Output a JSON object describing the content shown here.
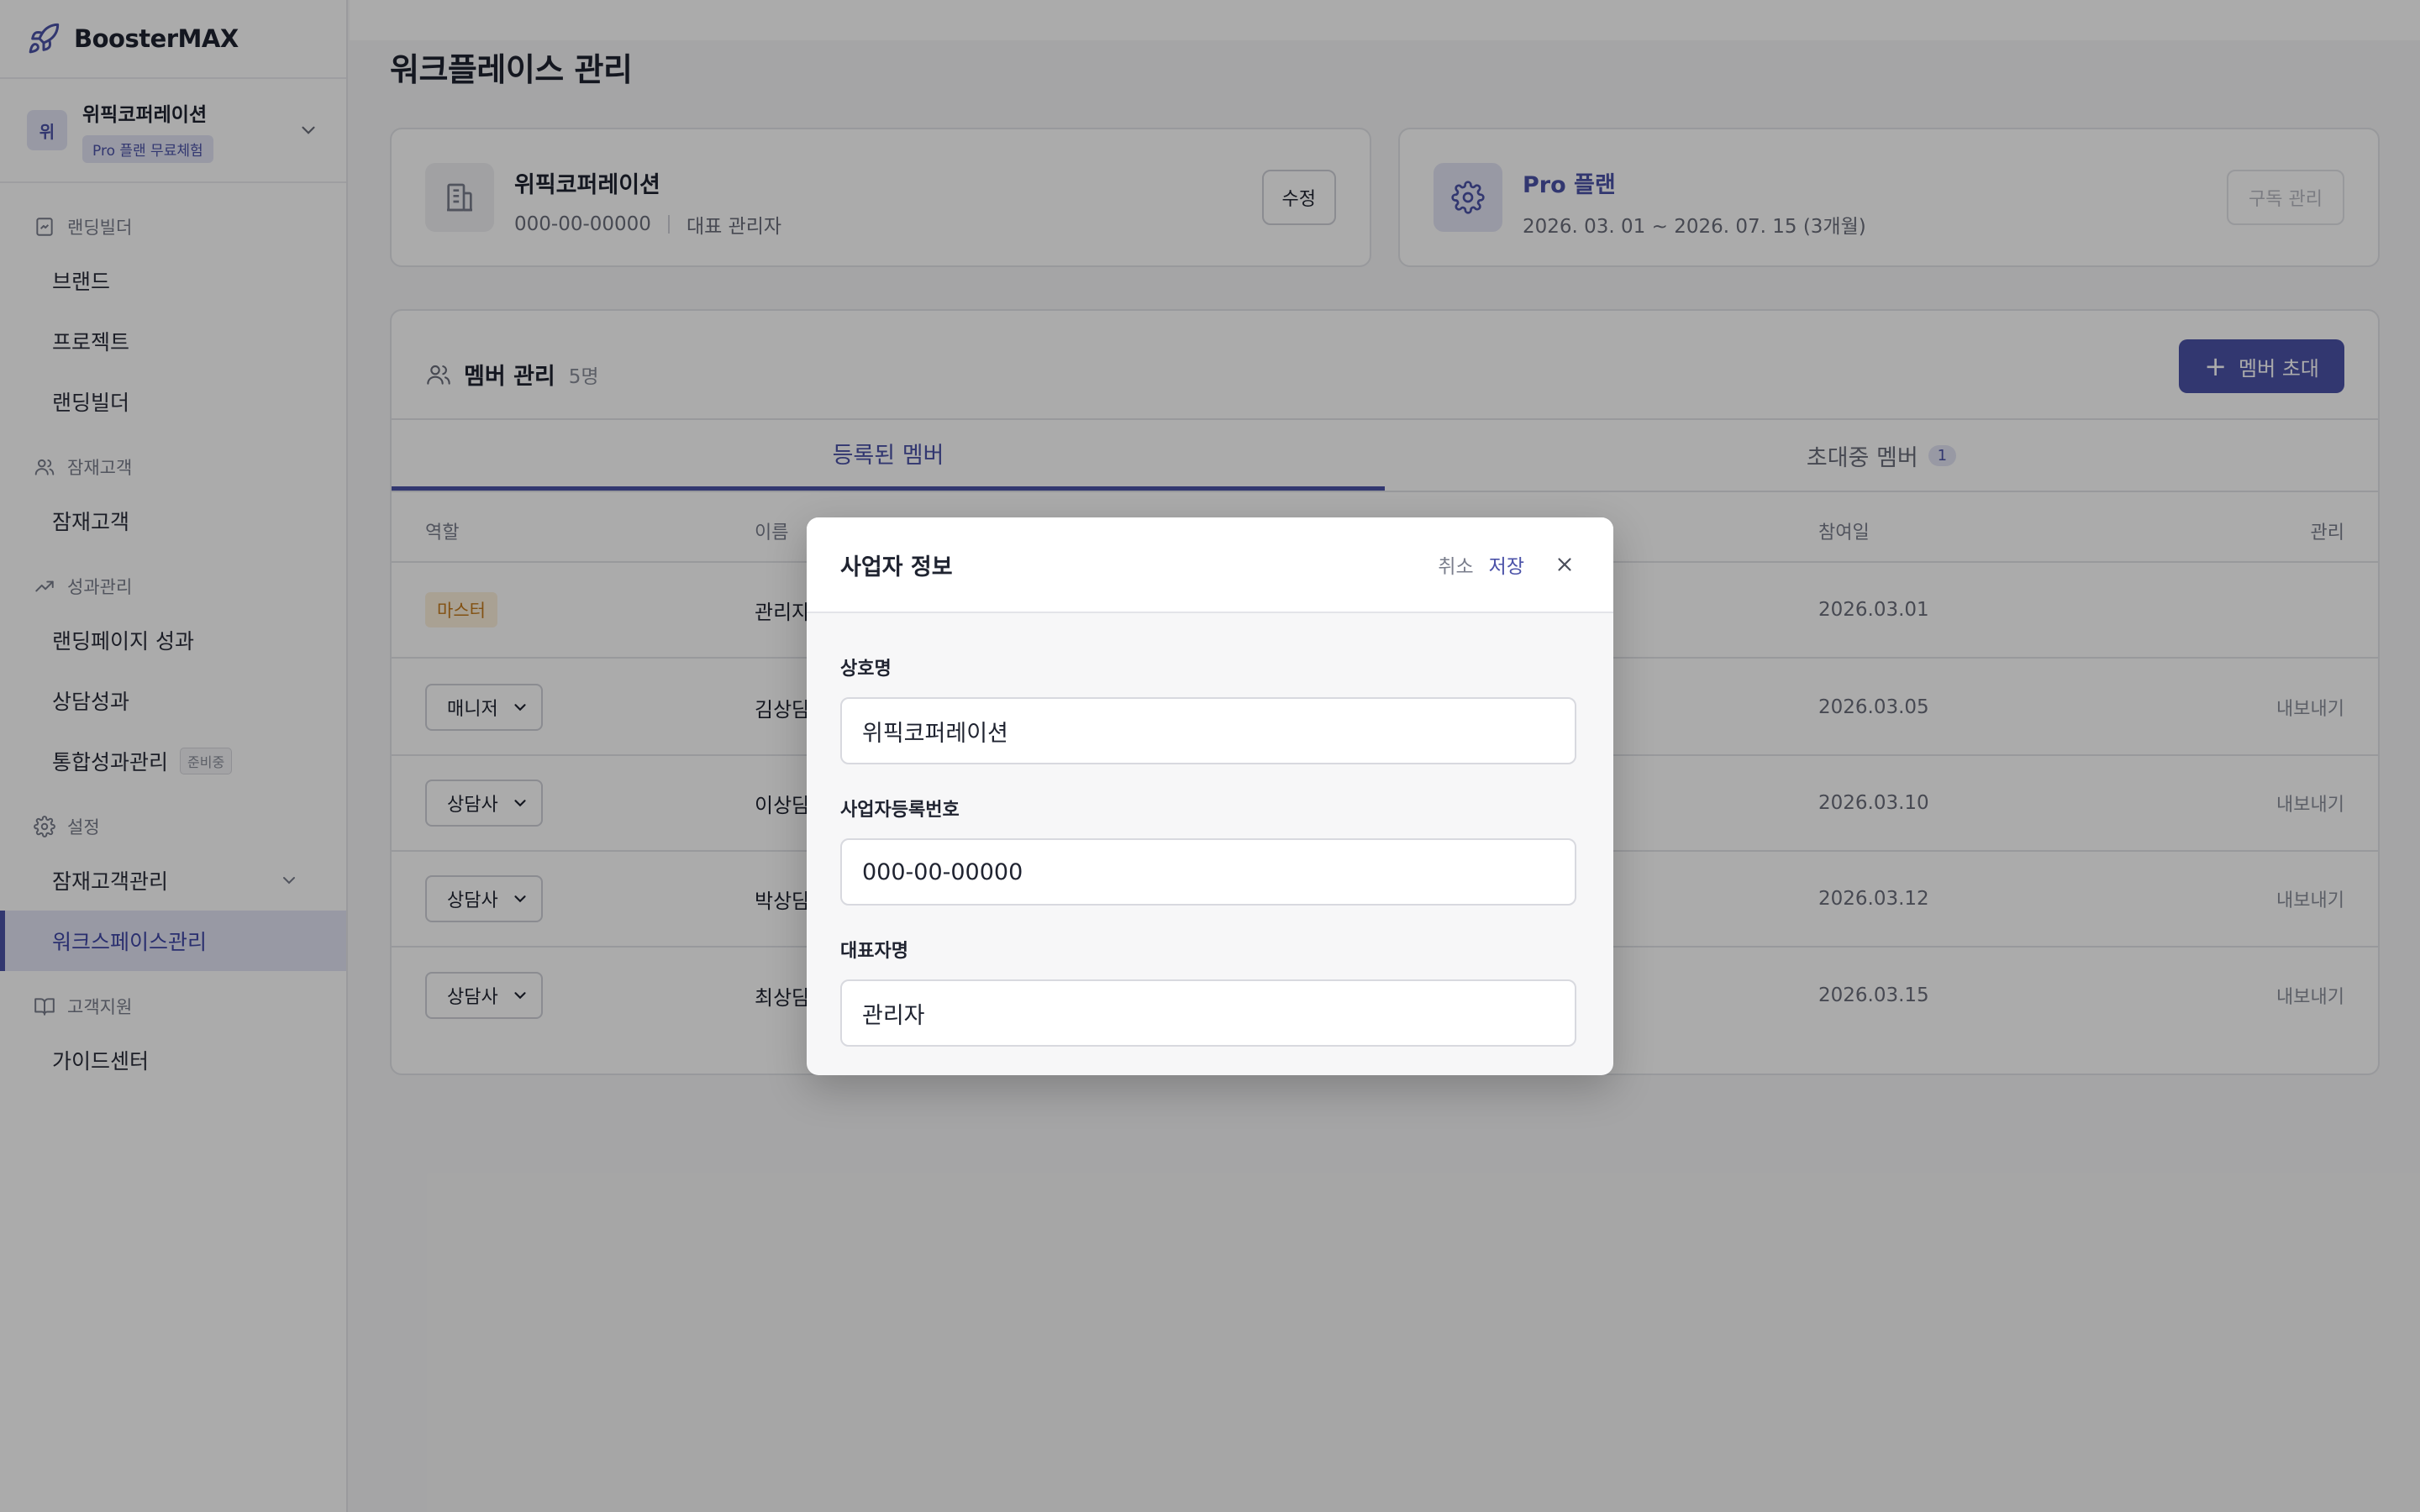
{
  "brand": {
    "name": "BoosterMAX",
    "icon": "rocket-icon"
  },
  "workspace": {
    "avatar": "위",
    "name": "위픽코퍼레이션",
    "badge": "Pro 플랜 무료체험"
  },
  "sidebar": {
    "sections": [
      {
        "label": "랜딩빌더",
        "icon": "landing-doc-icon",
        "items": [
          {
            "label": "브랜드"
          },
          {
            "label": "프로젝트"
          },
          {
            "label": "랜딩빌더"
          }
        ]
      },
      {
        "label": "잠재고객",
        "icon": "users-icon",
        "items": [
          {
            "label": "잠재고객"
          }
        ]
      },
      {
        "label": "성과관리",
        "icon": "trend-up-icon",
        "items": [
          {
            "label": "랜딩페이지 성과"
          },
          {
            "label": "상담성과"
          },
          {
            "label": "통합성과관리",
            "badge": "준비중"
          }
        ]
      },
      {
        "label": "설정",
        "icon": "gear-icon",
        "items": [
          {
            "label": "잠재고객관리"
          },
          {
            "label": "워크스페이스관리"
          }
        ]
      },
      {
        "label": "고객지원",
        "icon": "book-icon",
        "items": [
          {
            "label": "가이드센터"
          }
        ]
      }
    ]
  },
  "main": {
    "title": "워크플레이스 관리",
    "business_card": {
      "name": "위픽코퍼레이션",
      "reg_number": "000-00-00000",
      "role": "대표 관리자",
      "edit_label": "수정"
    },
    "plan_card": {
      "name": "Pro 플랜",
      "period": "2026. 03. 01 ~ 2026. 07. 15 (3개월)",
      "manage_label": "구독 관리"
    },
    "members": {
      "title": "멤버 관리",
      "count": "5명",
      "invite_label": "멤버 초대",
      "tabs": [
        {
          "label": "등록된 멤버"
        },
        {
          "label": "초대중 멤버",
          "count": "1"
        }
      ],
      "columns": {
        "role": "역할",
        "name": "이름",
        "joined": "참여일",
        "manage": "관리"
      },
      "rows": [
        {
          "role": "마스터",
          "name": "관리자",
          "joined": "2026.03.01",
          "action": ""
        },
        {
          "role": "매니저",
          "name": "김상담",
          "joined": "2026.03.05",
          "action": "내보내기"
        },
        {
          "role": "상담사",
          "name": "이상담",
          "joined": "2026.03.10",
          "action": "내보내기"
        },
        {
          "role": "상담사",
          "name": "박상담",
          "joined": "2026.03.12",
          "action": "내보내기"
        },
        {
          "role": "상담사",
          "name": "최상담",
          "joined": "2026.03.15",
          "action": "내보내기"
        }
      ]
    }
  },
  "modal": {
    "title": "사업자 정보",
    "cancel_label": "취소",
    "save_label": "저장",
    "fields": [
      {
        "label": "상호명",
        "value": "위픽코퍼레이션"
      },
      {
        "label": "사업자등록번호",
        "value": "000-00-00000"
      },
      {
        "label": "대표자명",
        "value": "관리자"
      }
    ]
  },
  "colors": {
    "accent": "#4b52a8",
    "accent_soft": "#e3e5f5",
    "master_badge": "#c27a1c"
  }
}
